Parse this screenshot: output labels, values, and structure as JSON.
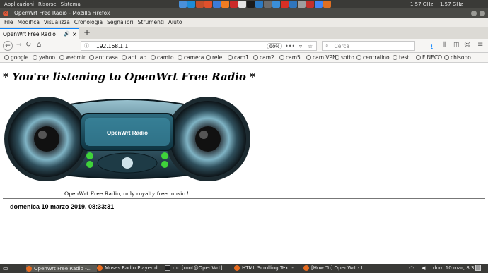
{
  "system": {
    "menus": [
      "Applicazioni",
      "Risorse",
      "Sistema"
    ],
    "cpu_freq_1": "1,57 GHz",
    "cpu_freq_2": "1,57 GHz",
    "tray_colors": [
      "#4a90d9",
      "#1d8bd6",
      "#c24f2b",
      "#e0502b",
      "#3b7bd8",
      "#ef7d22",
      "#cc2a2a",
      "#e4e4e4",
      "#1c1c1c",
      "#2b79c2",
      "#6d6d6d",
      "#3a8fd8",
      "#d93025",
      "#2f76bd",
      "#9e9e9e",
      "#c4302b",
      "#4285f4",
      "#e06f22"
    ]
  },
  "window": {
    "title": "OpenWrt Free Radio - Mozilla Firefox"
  },
  "menubar": [
    "File",
    "Modifica",
    "Visualizza",
    "Cronologia",
    "Segnalibri",
    "Strumenti",
    "Aiuto"
  ],
  "tab": {
    "label": "OpenWrt Free Radio",
    "new_tab": "+"
  },
  "nav": {
    "url": "192.168.1.1",
    "zoom": "90%",
    "search_placeholder": "Cerca"
  },
  "bookmarks": [
    "google",
    "yahoo",
    "webmin",
    "ant.casa",
    "ant.lab",
    "camto",
    "camera",
    "rele",
    "cam1",
    "cam2",
    "cam5",
    "cam VPN",
    "sotto",
    "centralino",
    "test",
    "FINECO",
    "chisono"
  ],
  "page": {
    "heading": "* You're listening to OpenWrt Free Radio *",
    "player_label": "OpenWrt Radio",
    "caption": "OpenWrt Free Radio, only royalty free music !",
    "datetime": "domenica 10 marzo 2019, 08:33:31"
  },
  "taskbar": {
    "tasks": [
      "OpenWrt Free Radio -...",
      "Muses Radio Player d...",
      "mc [root@OpenWrt]:...",
      "HTML Scrolling Text -...",
      "[How To] OpenWrt - I..."
    ],
    "clock": "dom 10 mar, 8.33"
  }
}
